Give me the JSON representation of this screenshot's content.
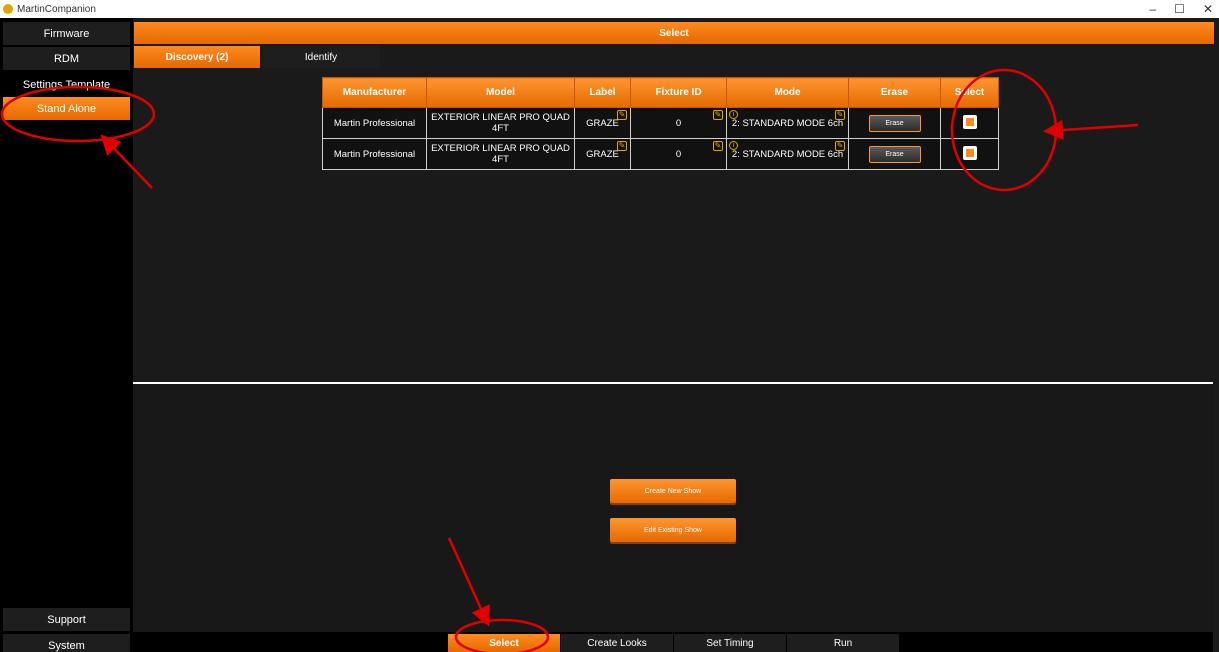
{
  "window": {
    "title": "MartinCompanion",
    "minimize": "–",
    "maximize": "☐",
    "close": "✕"
  },
  "sidebar": {
    "items": [
      {
        "label": "Firmware"
      },
      {
        "label": "RDM"
      },
      {
        "label": "Settings Template"
      },
      {
        "label": "Stand Alone"
      }
    ],
    "bottom": [
      {
        "label": "Support"
      },
      {
        "label": "System"
      }
    ]
  },
  "header": {
    "title": "Select"
  },
  "tabs": [
    {
      "label": "Discovery (2)"
    },
    {
      "label": "Identify"
    }
  ],
  "table": {
    "columns": [
      "Manufacturer",
      "Model",
      "Label",
      "Fixture ID",
      "Mode",
      "Erase",
      "Select"
    ],
    "rows": [
      {
        "manufacturer": "Martin Professional",
        "model": "EXTERIOR LINEAR PRO QUAD 4FT",
        "label": "GRAZE",
        "fixture_id": "0",
        "mode": "2: STANDARD MODE 6ch",
        "erase": "Erase"
      },
      {
        "manufacturer": "Martin Professional",
        "model": "EXTERIOR LINEAR PRO QUAD 4FT",
        "label": "GRAZE",
        "fixture_id": "0",
        "mode": "2: STANDARD MODE 6ch",
        "erase": "Erase"
      }
    ]
  },
  "actions": {
    "create_new_show": "Create New Show",
    "edit_existing_show": "Edit Existing Show"
  },
  "bottom_nav": [
    {
      "label": "Select"
    },
    {
      "label": "Create Looks"
    },
    {
      "label": "Set Timing"
    },
    {
      "label": "Run"
    }
  ],
  "colors": {
    "accent": "#ff8a1f",
    "annotation": "#e00000",
    "background": "#1a1a1a"
  }
}
